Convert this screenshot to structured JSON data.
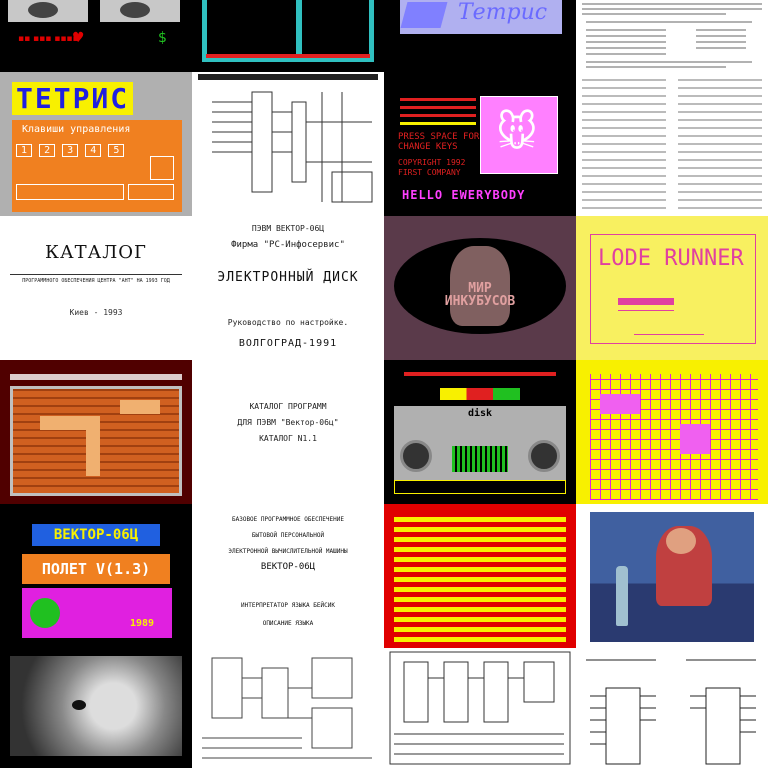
{
  "colors": {
    "yellow": "#f8f000",
    "orange": "#f08020",
    "magenta": "#e020e0",
    "pink": "#ff80c0",
    "red": "#e00000",
    "blue": "#2020e0",
    "green": "#20c020",
    "gray": "#b0b0b0",
    "brick": "#d06020"
  },
  "tiles": {
    "t02_title": "Тетрис",
    "t05_title": "ТЕТРИС",
    "t05_subtitle": "Клавиши управления",
    "t05_keys": [
      "1",
      "2",
      "3",
      "4",
      "5"
    ],
    "t07_lines": [
      "PRESS SPACE FOR",
      "CHANGE KEYS",
      "COPYRIGHT 1992",
      "FIRST COMPANY"
    ],
    "t07_hello": "HELLO EWERYBODY",
    "t08_title": "КАТАЛОГ",
    "t08_subtitle": "ПРОГРАММНОГО ОБЕСПЕЧЕНИЯ ЦЕНТРА \"АНТ\" НА 1993 ГОД",
    "t08_city": "Киев - 1993",
    "t09_top": "ПЭВМ ВЕКТОР-06Ц",
    "t09_firm": "Фирма \"РС-Инфосервис\"",
    "t09_title": "ЭЛЕКТРОННЫЙ ДИСК",
    "t09_manual": "Руководство по настройке.",
    "t09_city": "ВОЛГОГРАД-1991",
    "t10_title": "МИР ИНКУБУСОВ",
    "t11_title": "LODE RUNNER",
    "t13_lines": [
      "КАТАЛОГ ПРОГРАММ",
      "ДЛЯ ПЭВМ \"Вектор-06ц\"",
      "КАТАЛОГ N1.1"
    ],
    "t14_disk": "disk",
    "t16_title": "ВЕКТОР-06Ц",
    "t16_sub": "ПОЛЕТ V(1.3)",
    "t16_year": "1989",
    "t17_lines": [
      "БАЗОВОЕ ПРОГРАММНОЕ ОБЕСПЕЧЕНИЕ",
      "БЫТОВОЙ ПЕРСОНАЛЬНОЙ",
      "ЭЛЕКТРОННОЙ ВЫЧИСЛИТЕЛЬНОЙ МАШИНЫ",
      "ВЕКТОР-06Ц",
      "ИНТЕРПРЕТАТОР ЯЗЫКА БЕЙСИК",
      "ОПИСАНИЕ ЯЗЫКА"
    ]
  }
}
